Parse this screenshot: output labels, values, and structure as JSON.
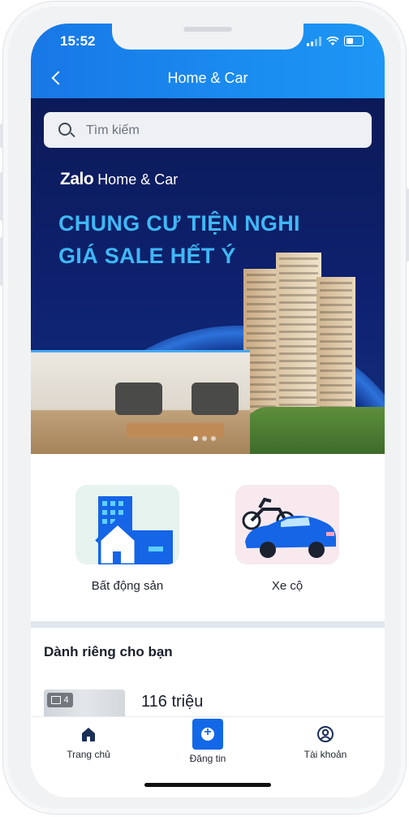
{
  "status_bar": {
    "time": "15:52"
  },
  "header": {
    "title": "Home & Car"
  },
  "search": {
    "placeholder": "Tìm kiếm"
  },
  "banner": {
    "brand_zalo": "Zalo",
    "brand_rest": "Home & Car",
    "headline_line1": "CHUNG CƯ TIỆN NGHI",
    "headline_line2": "GIÁ SALE HẾT Ý",
    "slides_total": 3,
    "active_slide": 1
  },
  "categories": [
    {
      "label": "Bất động sản",
      "icon": "building-icon"
    },
    {
      "label": "Xe cộ",
      "icon": "vehicle-icon"
    }
  ],
  "section": {
    "title": "Dành riêng cho bạn"
  },
  "listing": {
    "image_count": "4",
    "price": "116 triệu"
  },
  "tabbar": [
    {
      "label": "Trang chủ",
      "icon": "home-icon"
    },
    {
      "label": "Đăng tin",
      "icon": "add-post-icon"
    },
    {
      "label": "Tài khoản",
      "icon": "account-icon"
    }
  ],
  "colors": {
    "header": "#1a8cf0",
    "banner_bg": "#0e2170",
    "headline": "#3fb8f5",
    "post_button": "#1368e8"
  }
}
